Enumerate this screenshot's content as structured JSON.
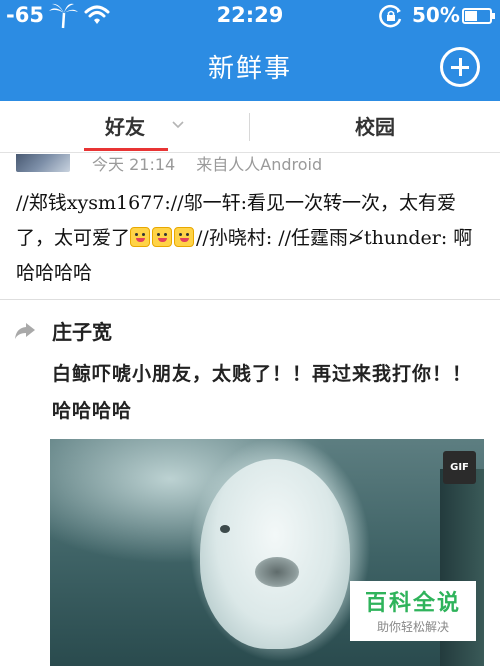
{
  "status_bar": {
    "signal": "-65",
    "time": "22:29",
    "battery": "50%"
  },
  "nav": {
    "title": "新鲜事",
    "compose_icon": "plus-circle-icon"
  },
  "tabs": [
    {
      "label": "好友",
      "active": true
    },
    {
      "label": "校园",
      "active": false
    }
  ],
  "colors": {
    "nav_blue": "#2c8ce3",
    "tab_underline": "#e83434",
    "watermark_green": "#2fb35b"
  },
  "posts": [
    {
      "time": "今天 21:14",
      "source": "来自人人Android",
      "text_part1": "//郑钱xysm1677://邬一轩:看见一次转一次，太有爱了，太可爱了",
      "emoji": [
        "smile-emoji",
        "smile-emoji",
        "shy-emoji"
      ],
      "text_part2": "//孙晓村: //任霆雨≯thunder: 啊哈哈哈哈"
    },
    {
      "author": "庄子宽",
      "text": "白鲸吓唬小朋友，太贱了！！再过来我打你！！哈哈哈哈",
      "media_badge": "GIF"
    }
  ],
  "watermark": {
    "title": "百科全说",
    "subtitle": "助你轻松解决"
  }
}
